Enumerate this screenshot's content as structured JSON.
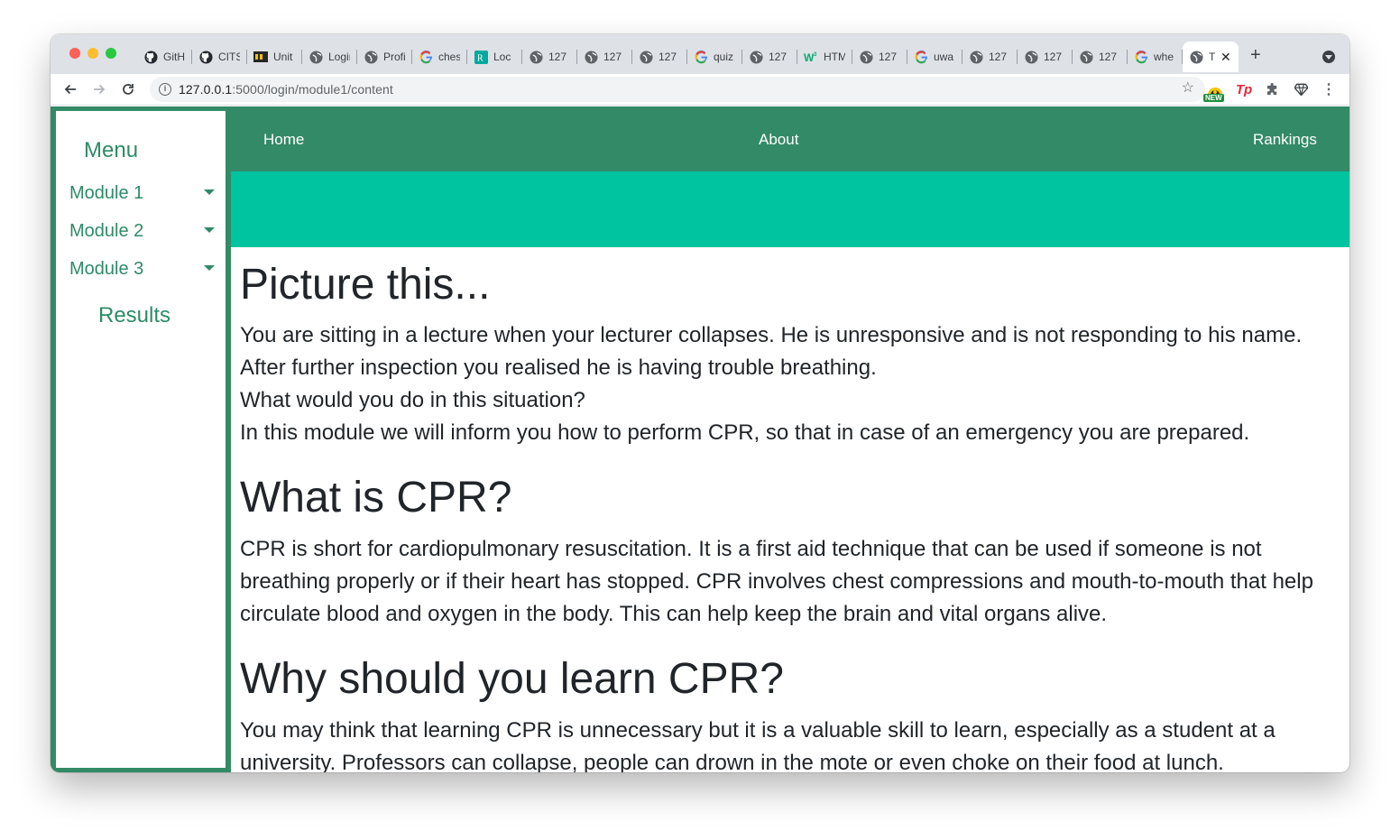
{
  "browser": {
    "tabs": [
      {
        "label": "GitHub",
        "icon": "github-icon"
      },
      {
        "label": "CITS",
        "icon": "github-icon"
      },
      {
        "label": "Unit",
        "icon": "blackboard-icon"
      },
      {
        "label": "Login",
        "icon": "globe-icon"
      },
      {
        "label": "Profile",
        "icon": "globe-icon"
      },
      {
        "label": "chest",
        "icon": "google-icon"
      },
      {
        "label": "Loc",
        "icon": "resuscitation-icon"
      },
      {
        "label": "127",
        "icon": "globe-icon"
      },
      {
        "label": "127",
        "icon": "globe-icon"
      },
      {
        "label": "127",
        "icon": "globe-icon"
      },
      {
        "label": "quiz",
        "icon": "google-icon"
      },
      {
        "label": "127",
        "icon": "globe-icon"
      },
      {
        "label": "HTML",
        "icon": "w3schools-icon"
      },
      {
        "label": "127",
        "icon": "globe-icon"
      },
      {
        "label": "uwa",
        "icon": "google-icon"
      },
      {
        "label": "127",
        "icon": "globe-icon"
      },
      {
        "label": "127",
        "icon": "globe-icon"
      },
      {
        "label": "127",
        "icon": "globe-icon"
      },
      {
        "label": "whe",
        "icon": "google-icon"
      },
      {
        "label": "T",
        "icon": "globe-icon",
        "active": true
      }
    ],
    "close_glyph": "✕",
    "new_tab_glyph": "+",
    "url_host": "127.0.0.1",
    "url_path": ":5000/login/module1/content",
    "info_glyph": "i",
    "star_glyph": "☆",
    "ext_new_badge": "NEW",
    "ext_tp_label": "Tp",
    "kebab_glyph": "⋮"
  },
  "sidebar": {
    "title": "Menu",
    "items": [
      {
        "label": "Module 1"
      },
      {
        "label": "Module 2"
      },
      {
        "label": "Module 3"
      }
    ],
    "results_label": "Results"
  },
  "navbar": {
    "home": "Home",
    "about": "About",
    "rankings": "Rankings"
  },
  "content": {
    "h1_picture": "Picture this...",
    "p_picture_lines": [
      "You are sitting in a lecture when your lecturer collapses. He is unresponsive and is not responding to his name.",
      "After further inspection you realised he is having trouble breathing.",
      "What would you do in this situation?",
      "In this module we will inform you how to perform CPR, so that in case of an emergency you are prepared."
    ],
    "h1_what": "What is CPR?",
    "p_what": "CPR is short for cardiopulmonary resuscitation. It is a first aid technique that can be used if someone is not breathing properly or if their heart has stopped. CPR involves chest compressions and mouth-to-mouth that help circulate blood and oxygen in the body. This can help keep the brain and vital organs alive.",
    "h1_why": "Why should you learn CPR?",
    "p_why": "You may think that learning CPR is unnecessary but it is a valuable skill to learn, especially as a student at a university. Professors can collapse, people can drown in the mote or even choke on their food at lunch."
  },
  "colors": {
    "accent_green": "#338a67",
    "sidebar_text": "#2e8b68",
    "banner_teal": "#00c39f"
  }
}
